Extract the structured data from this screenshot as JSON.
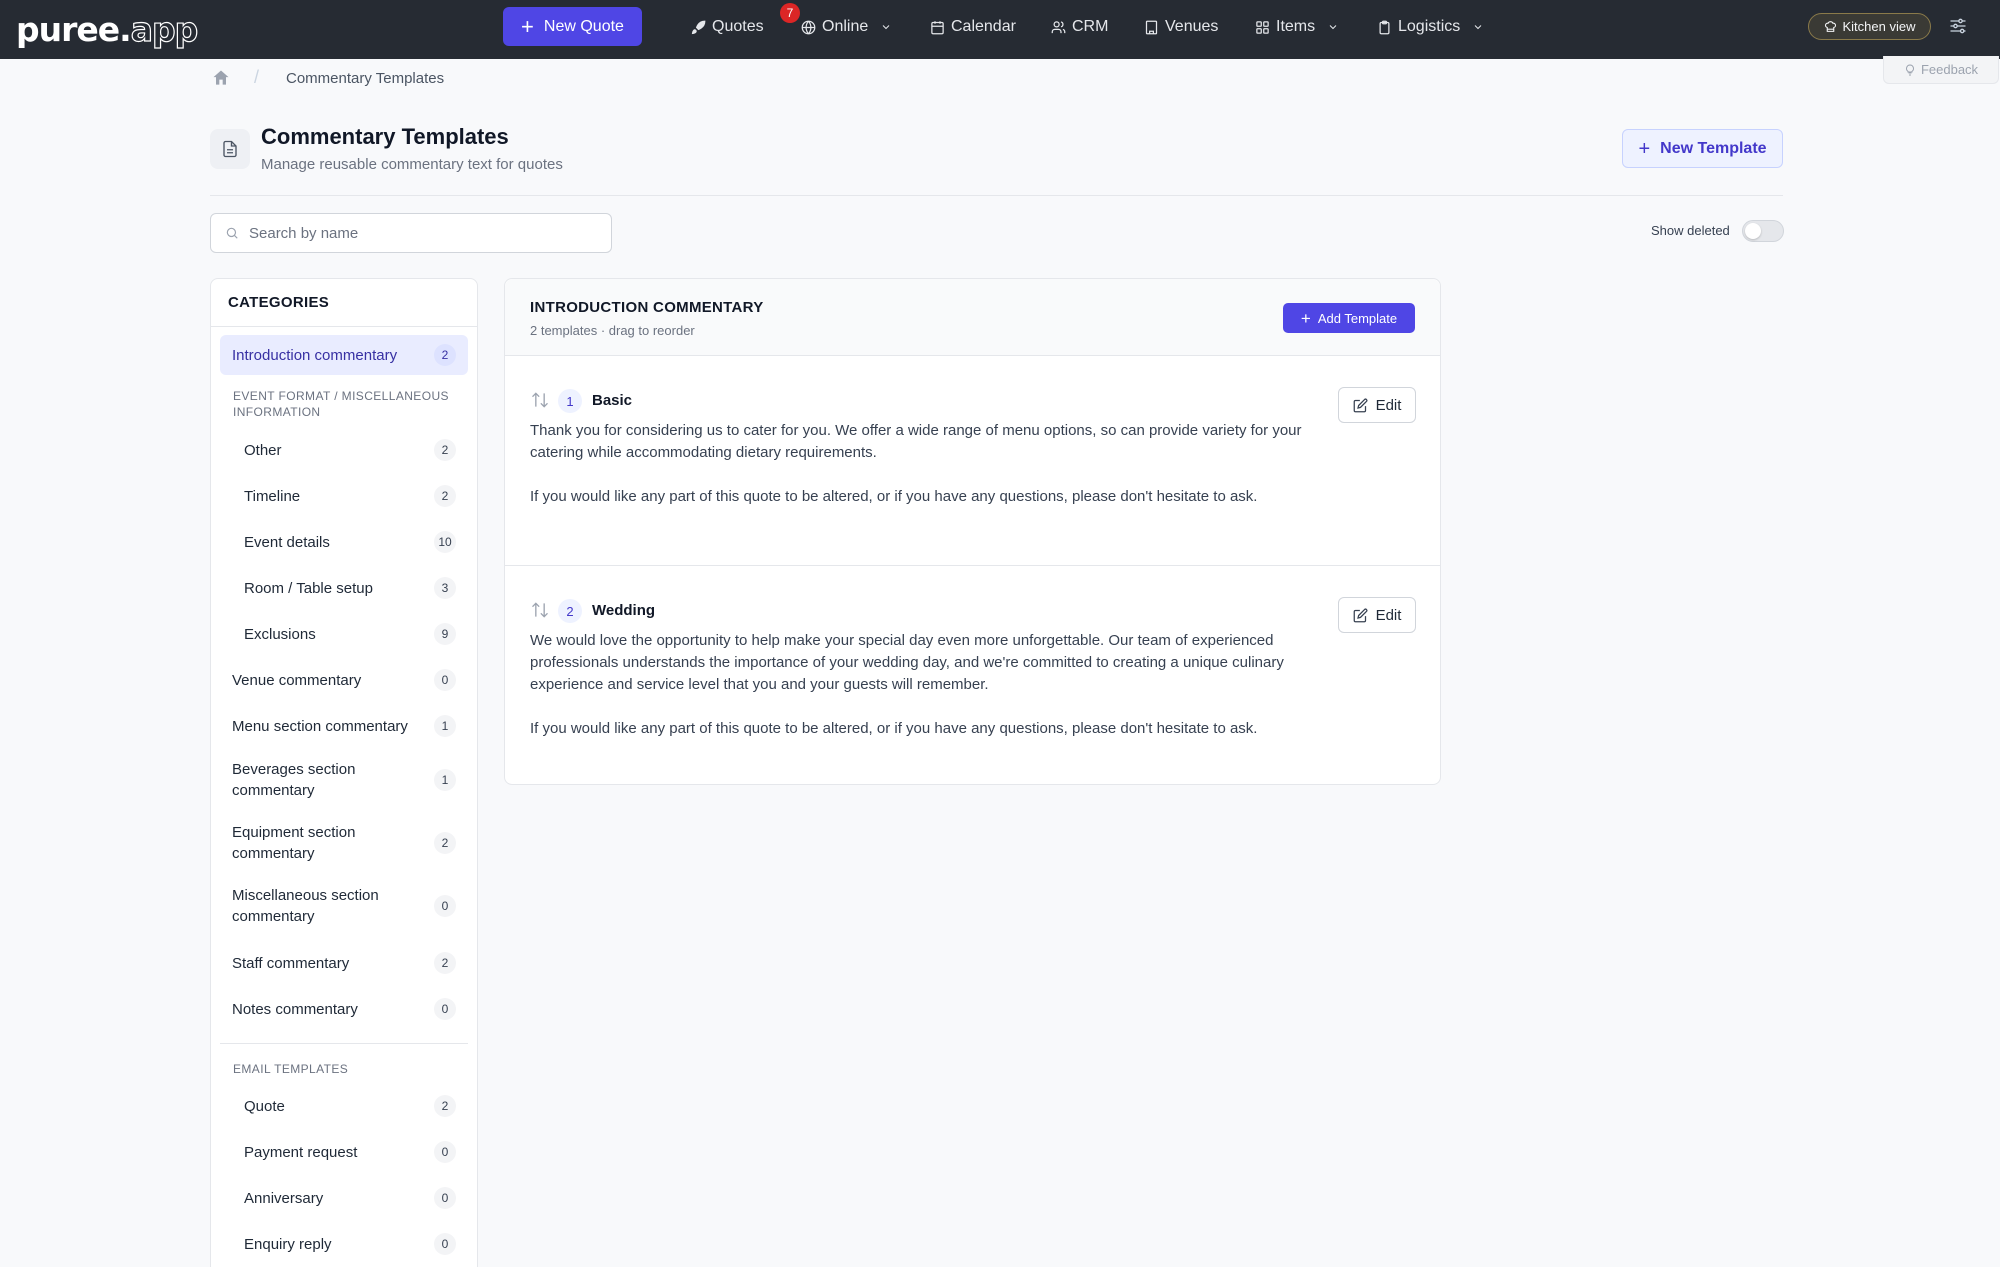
{
  "nav": {
    "logo_text": "puree.",
    "logo_app": "app",
    "new_quote_label": "New Quote",
    "items": {
      "quotes": "Quotes",
      "quotes_badge": "7",
      "online": "Online",
      "calendar": "Calendar",
      "crm": "CRM",
      "venues": "Venues",
      "items": "Items",
      "logistics": "Logistics"
    },
    "kitchen_view_label": "Kitchen view"
  },
  "breadcrumb": {
    "current": "Commentary Templates"
  },
  "feedback_label": "Feedback",
  "page": {
    "title": "Commentary Templates",
    "subtitle": "Manage reusable commentary text for quotes",
    "new_template_label": "New Template"
  },
  "search": {
    "placeholder": "Search by name",
    "value": ""
  },
  "show_deleted": {
    "label": "Show deleted",
    "enabled": false
  },
  "sidebar": {
    "title": "CATEGORIES",
    "intro": {
      "label": "Introduction commentary",
      "count": "2",
      "active": true
    },
    "group_event_format": "EVENT FORMAT / MISCELLANEOUS INFORMATION",
    "event_format_items": [
      {
        "label": "Other",
        "count": "2"
      },
      {
        "label": "Timeline",
        "count": "2"
      },
      {
        "label": "Event details",
        "count": "10"
      },
      {
        "label": "Room / Table setup",
        "count": "3"
      },
      {
        "label": "Exclusions",
        "count": "9"
      }
    ],
    "main_items": [
      {
        "label": "Venue commentary",
        "count": "0"
      },
      {
        "label": "Menu section commentary",
        "count": "1"
      },
      {
        "label": "Beverages section commentary",
        "count": "1"
      },
      {
        "label": "Equipment section commentary",
        "count": "2"
      },
      {
        "label": "Miscellaneous section commentary",
        "count": "0"
      },
      {
        "label": "Staff commentary",
        "count": "2"
      },
      {
        "label": "Notes commentary",
        "count": "0"
      }
    ],
    "group_email": "EMAIL TEMPLATES",
    "email_items": [
      {
        "label": "Quote",
        "count": "2"
      },
      {
        "label": "Payment request",
        "count": "0"
      },
      {
        "label": "Anniversary",
        "count": "0"
      },
      {
        "label": "Enquiry reply",
        "count": "0"
      }
    ]
  },
  "panel": {
    "title": "INTRODUCTION COMMENTARY",
    "subtitle": "2 templates · drag to reorder",
    "add_template_label": "Add Template",
    "edit_label": "Edit",
    "templates": [
      {
        "number": "1",
        "name": "Basic",
        "paragraph_1": "Thank you for considering us to cater for you. We offer a wide range of menu options, so can provide variety for your catering while accommodating dietary requirements.",
        "paragraph_2": "If you would like any part of this quote to be altered, or if you have any questions, please don't hesitate to ask."
      },
      {
        "number": "2",
        "name": "Wedding",
        "paragraph_1": "We would love the opportunity to help make your special day even more unforgettable. Our team of experienced professionals understands the importance of your wedding day, and we're committed to creating a unique culinary experience and service level that you and your guests will remember.",
        "paragraph_2": "If you would like any part of this quote to be altered, or if you have any questions, please don't hesitate to ask."
      }
    ]
  },
  "colors": {
    "topbar": "#262b33",
    "accent": "#4f46e5",
    "badge": "#dc2626"
  }
}
